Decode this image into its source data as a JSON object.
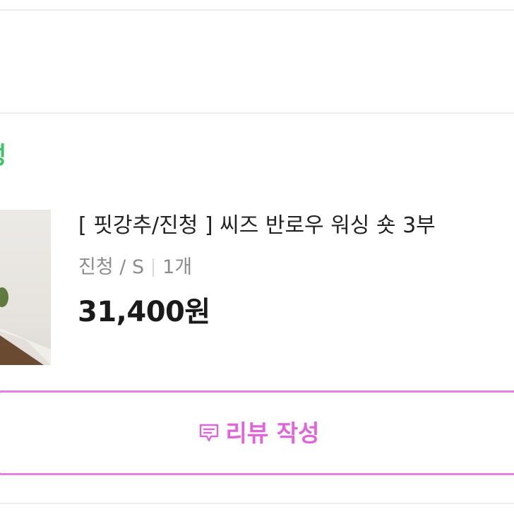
{
  "order_item": {
    "status_label": "성",
    "product_name": "[ 핏강추/진청 ] 씨즈 반로우 워싱 숏 3부",
    "option": {
      "color_size": "진청 / S",
      "quantity": "1개"
    },
    "price": "31,400원",
    "thumbnail_icon": "product-photo"
  },
  "review_button": {
    "label": "리뷰 작성",
    "icon": "chat-review-icon"
  },
  "colors": {
    "status_green": "#3fc16a",
    "review_pink": "#e065d8",
    "review_border": "#e57fe0",
    "option_gray": "#8c8c8c",
    "price_text": "#1a1a1a"
  }
}
